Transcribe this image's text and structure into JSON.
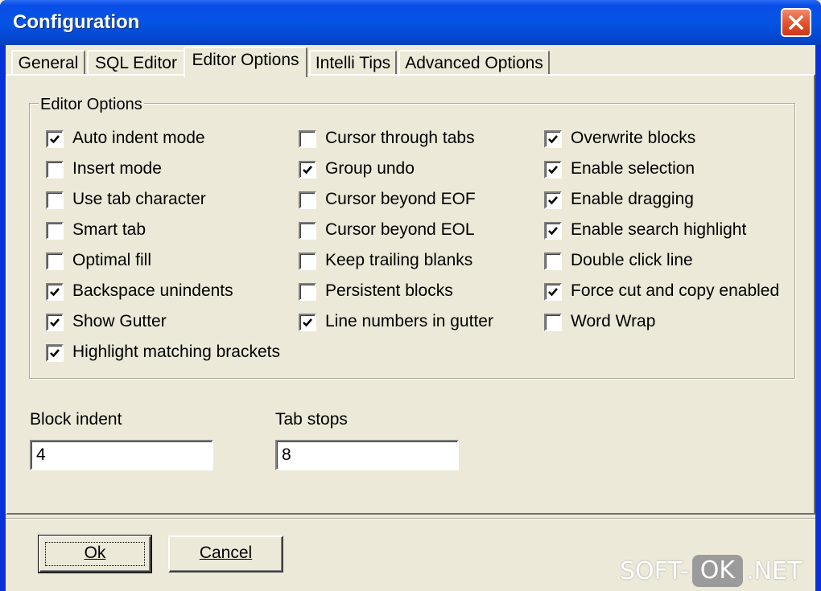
{
  "window": {
    "title": "Configuration"
  },
  "tabs": [
    {
      "label": "General",
      "active": false
    },
    {
      "label": "SQL Editor",
      "active": false
    },
    {
      "label": "Editor Options",
      "active": true
    },
    {
      "label": "Intelli Tips",
      "active": false
    },
    {
      "label": "Advanced Options",
      "active": false
    }
  ],
  "group": {
    "label": "Editor Options",
    "columns": [
      [
        {
          "label": "Auto indent mode",
          "checked": true
        },
        {
          "label": "Insert mode",
          "checked": false
        },
        {
          "label": "Use tab character",
          "checked": false
        },
        {
          "label": "Smart tab",
          "checked": false
        },
        {
          "label": "Optimal fill",
          "checked": false
        },
        {
          "label": "Backspace unindents",
          "checked": true
        },
        {
          "label": "Show Gutter",
          "checked": true
        },
        {
          "label": "Highlight matching brackets",
          "checked": true
        }
      ],
      [
        {
          "label": "Cursor through tabs",
          "checked": false
        },
        {
          "label": "Group undo",
          "checked": true
        },
        {
          "label": "Cursor beyond EOF",
          "checked": false
        },
        {
          "label": "Cursor beyond EOL",
          "checked": false
        },
        {
          "label": "Keep trailing blanks",
          "checked": false
        },
        {
          "label": "Persistent blocks",
          "checked": false
        },
        {
          "label": "Line numbers in gutter",
          "checked": true
        }
      ],
      [
        {
          "label": "Overwrite blocks",
          "checked": true
        },
        {
          "label": "Enable selection",
          "checked": true
        },
        {
          "label": "Enable dragging",
          "checked": true
        },
        {
          "label": "Enable search highlight",
          "checked": true
        },
        {
          "label": "Double click line",
          "checked": false
        },
        {
          "label": "Force cut and copy enabled",
          "checked": true
        },
        {
          "label": "Word Wrap",
          "checked": false
        }
      ]
    ]
  },
  "fields": {
    "block_indent": {
      "label": "Block indent",
      "value": "4"
    },
    "tab_stops": {
      "label": "Tab stops",
      "value": "8"
    }
  },
  "buttons": {
    "ok": "Ok",
    "cancel": "Cancel"
  },
  "watermark": {
    "left": "SOFT-",
    "middle": "OK",
    "right": ".NET"
  }
}
